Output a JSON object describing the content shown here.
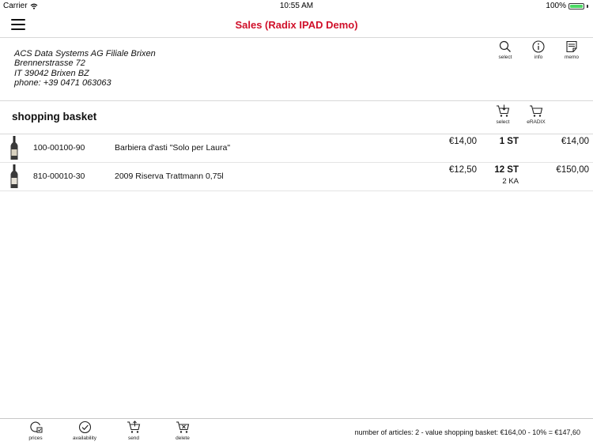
{
  "status_bar": {
    "carrier": "Carrier",
    "time": "10:55 AM",
    "battery": "100%",
    "battery_level": 1.0
  },
  "nav": {
    "title": "Sales (Radix IPAD Demo)",
    "title_color": "#d0102a"
  },
  "customer": {
    "lines": [
      "ACS Data Systems AG Filiale Brixen",
      "Brennerstrasse 72",
      "IT  39042 Brixen BZ",
      "phone: +39 0471 063063"
    ],
    "tools": [
      {
        "label": "select",
        "icon": "search-icon"
      },
      {
        "label": "info",
        "icon": "info-icon"
      },
      {
        "label": "memo",
        "icon": "memo-icon"
      }
    ]
  },
  "basket": {
    "title": "shopping basket",
    "tools": [
      {
        "label": "select",
        "icon": "cart-select-icon"
      },
      {
        "label": "eRADIX",
        "icon": "cart-icon"
      }
    ],
    "rows": [
      {
        "article_no": "100-00100-90",
        "description": "Barbiera d'asti \"Solo per Laura\"",
        "price": "€14,00",
        "quantity": "1 ST",
        "quantity2": "",
        "total": "€14,00"
      },
      {
        "article_no": "810-00010-30",
        "description": "2009  Riserva Trattmann 0,75l",
        "price": "€12,50",
        "quantity": "12 ST",
        "quantity2": "2 KA",
        "total": "€150,00"
      }
    ]
  },
  "bottom": {
    "tools": [
      {
        "label": "prices",
        "icon": "prices-icon"
      },
      {
        "label": "availability",
        "icon": "check-circle-icon"
      },
      {
        "label": "send",
        "icon": "cart-send-icon"
      },
      {
        "label": "delete",
        "icon": "cart-delete-icon"
      }
    ],
    "summary": "number of articles: 2 - value shopping basket: €164,00 - 10%  = €147,60"
  }
}
